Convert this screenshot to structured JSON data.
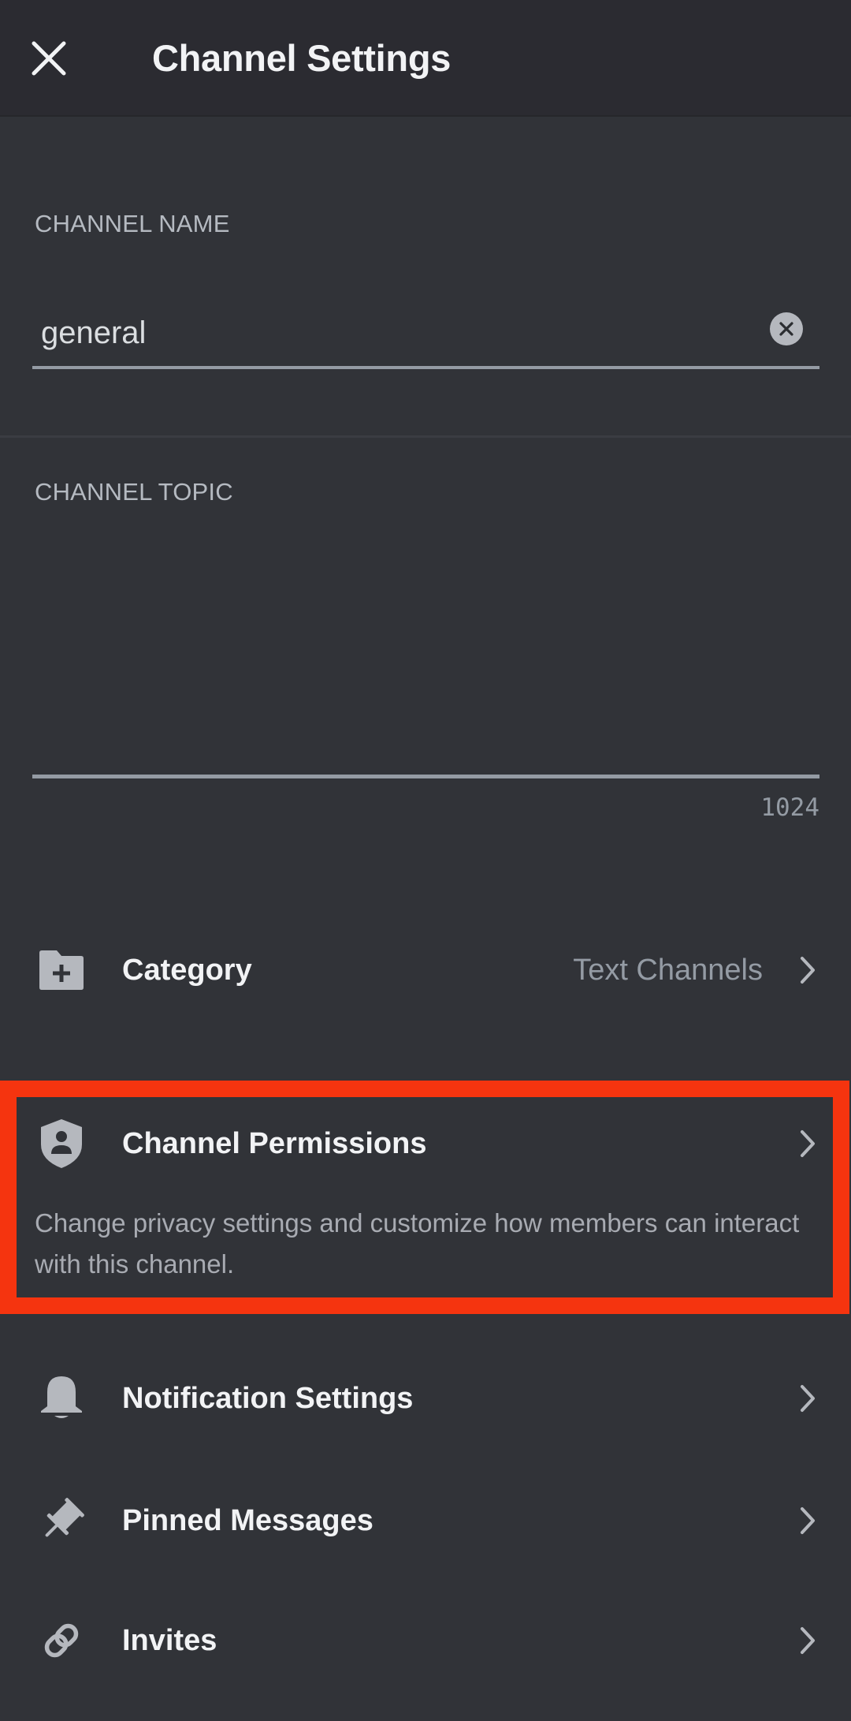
{
  "header": {
    "title": "Channel Settings",
    "close_icon": "close-icon"
  },
  "channel_name": {
    "label": "CHANNEL NAME",
    "value": "general",
    "placeholder": "",
    "clear_icon": "clear-circle-icon"
  },
  "channel_topic": {
    "label": "CHANNEL TOPIC",
    "value": "",
    "placeholder": "",
    "char_remaining": "1024"
  },
  "rows": {
    "category": {
      "icon": "folder-plus-icon",
      "label": "Category",
      "value": "Text Channels"
    },
    "permissions": {
      "icon": "shield-person-icon",
      "label": "Channel Permissions",
      "description": "Change privacy settings and customize how members can interact with this channel.",
      "highlighted": true
    },
    "notifications": {
      "icon": "bell-icon",
      "label": "Notification Settings"
    },
    "pinned": {
      "icon": "pin-icon",
      "label": "Pinned Messages"
    },
    "invites": {
      "icon": "link-icon",
      "label": "Invites"
    }
  },
  "colors": {
    "background": "#313338",
    "header_background": "#2b2b31",
    "highlight_border": "#f5340f",
    "icon": "#b5b8be",
    "muted_text": "#949ba4"
  }
}
